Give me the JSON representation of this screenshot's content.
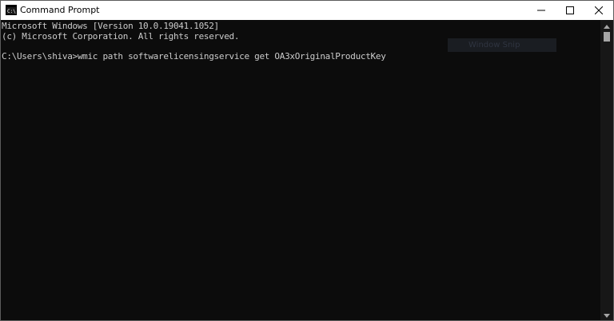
{
  "window": {
    "title": "Command Prompt",
    "icon": "command-prompt-icon",
    "controls": [
      "minimize-icon",
      "maximize-icon",
      "close-icon"
    ]
  },
  "console": {
    "lines": [
      "Microsoft Windows [Version 10.0.19041.1052]",
      "(c) Microsoft Corporation. All rights reserved.",
      "C:\\Users\\shiva>wmic path softwarelicensingservice get OA3xOriginalProductKey"
    ],
    "text_color": "#cccccc",
    "background_color": "#0c0c0c"
  },
  "overlay": {
    "label": "Window Snip"
  }
}
